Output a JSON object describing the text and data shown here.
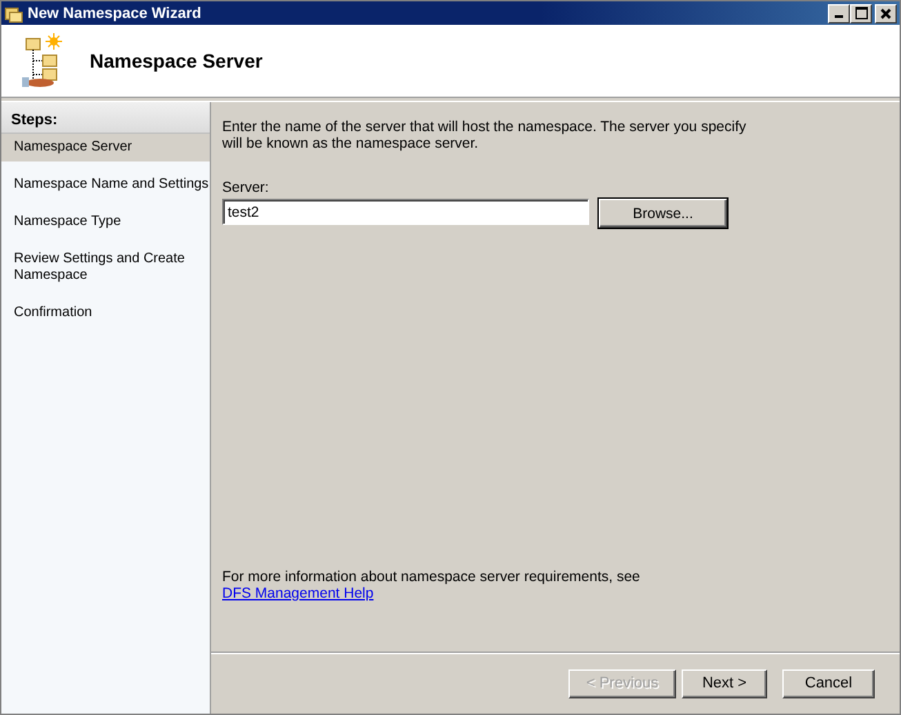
{
  "window": {
    "title": "New Namespace Wizard"
  },
  "header": {
    "title": "Namespace Server"
  },
  "steps": {
    "heading": "Steps:",
    "items": [
      {
        "label": "Namespace Server",
        "selected": true
      },
      {
        "label": "Namespace Name and Settings",
        "selected": false
      },
      {
        "label": "Namespace Type",
        "selected": false
      },
      {
        "label": "Review Settings and Create Namespace",
        "selected": false
      },
      {
        "label": "Confirmation",
        "selected": false
      }
    ]
  },
  "content": {
    "intro": "Enter the name of the server that will host the namespace. The server you specify will be known as the namespace server.",
    "server_label": "Server:",
    "server_value": "test2",
    "browse_button": "Browse...",
    "help_text": "For more information about namespace server requirements, see",
    "help_link": "DFS Management Help"
  },
  "buttons": [
    {
      "label": "< Previous",
      "disabled": true
    },
    {
      "label": "Next >",
      "disabled": false
    },
    {
      "label": "Cancel",
      "disabled": false
    }
  ]
}
